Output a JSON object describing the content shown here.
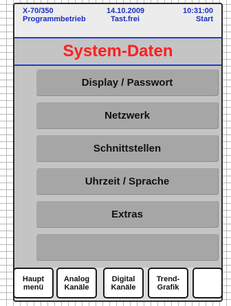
{
  "status": {
    "device": "X-70/350",
    "mode": "Programmbetrieb",
    "date": "14.10.2009",
    "keypad": "Tast.frei",
    "time": "10:31:00",
    "action": "Start"
  },
  "title": "System-Daten",
  "menu": {
    "items": [
      "Display / Passwort",
      "Netzwerk",
      "Schnittstellen",
      "Uhrzeit / Sprache",
      "Extras",
      ""
    ]
  },
  "softkeys": [
    {
      "line1": "Haupt",
      "line2": "menü"
    },
    {
      "line1": "Analog",
      "line2": "Kanäle"
    },
    {
      "line1": "Digital",
      "line2": "Kanäle"
    },
    {
      "line1": "Trend-",
      "line2": "Grafik"
    },
    {
      "line1": "",
      "line2": ""
    }
  ],
  "colors": {
    "title": "#ff1f1f",
    "status_text": "#1a2fbf",
    "separator": "#1a3fd0",
    "panel": "#c4c4c4",
    "button": "#a6a6a6"
  }
}
